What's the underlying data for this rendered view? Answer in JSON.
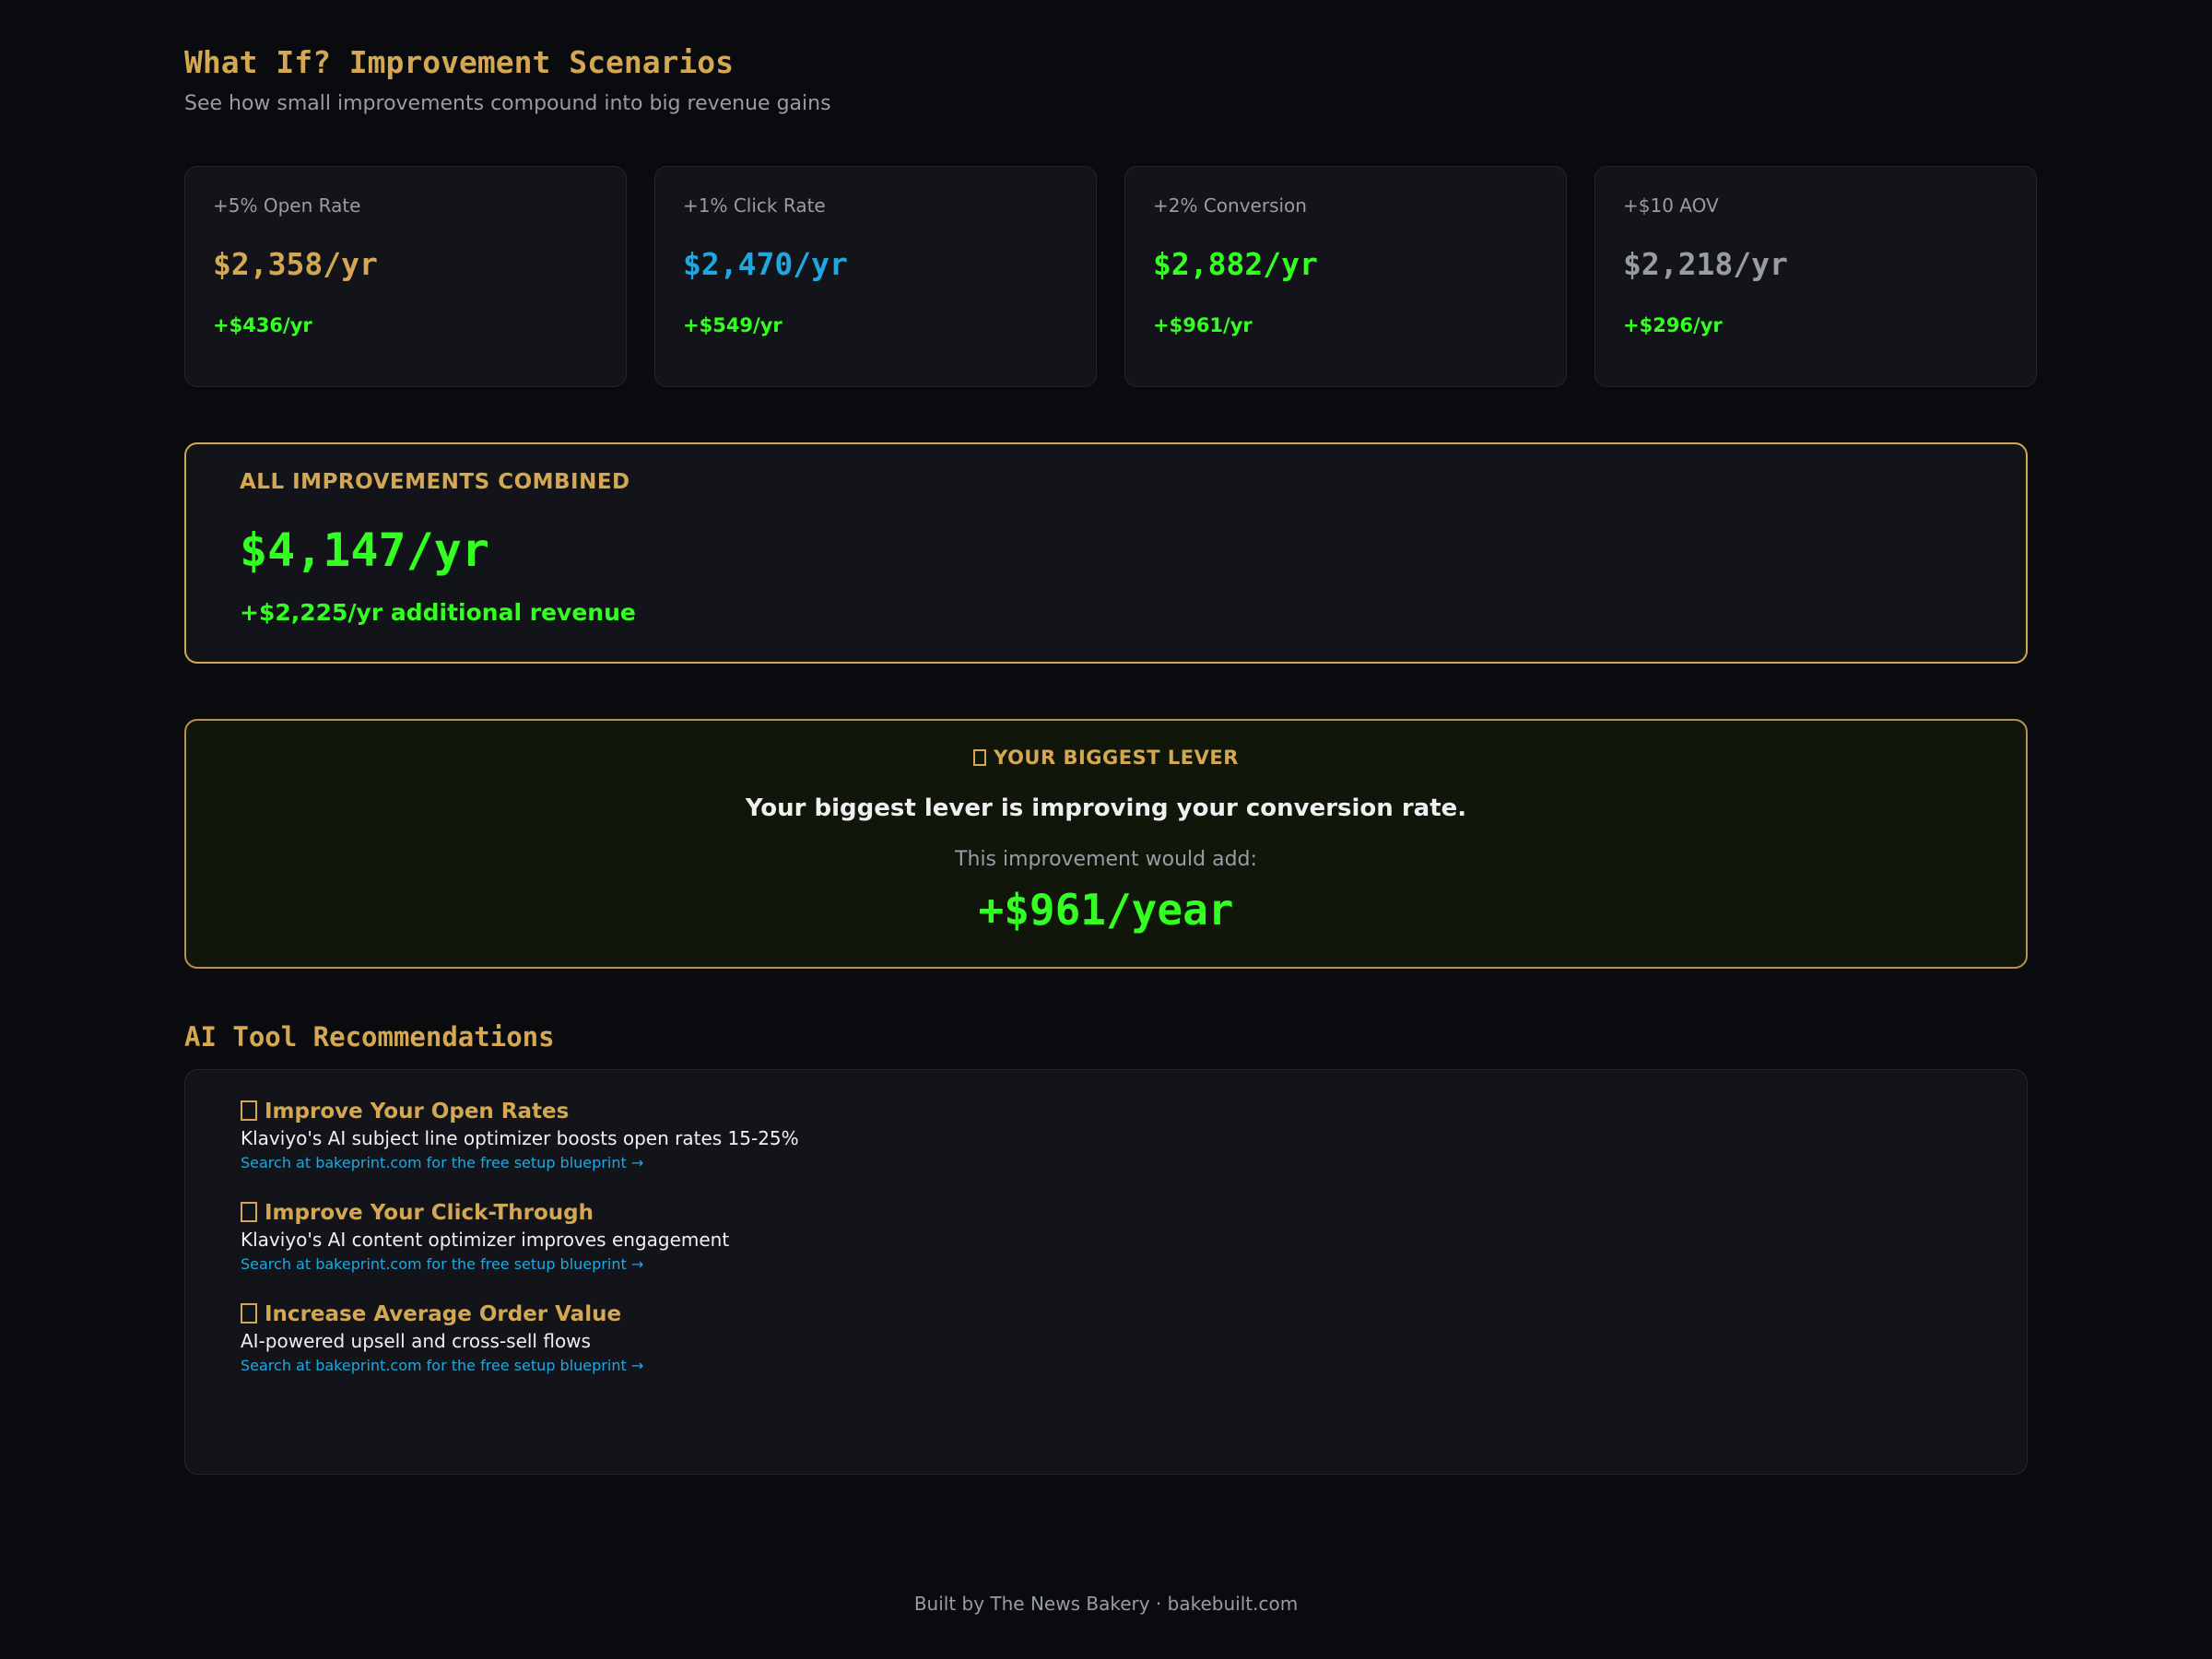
{
  "header": {
    "title": "What If? Improvement Scenarios",
    "subtitle": "See how small improvements compound into big revenue gains"
  },
  "scenarios": [
    {
      "label": "+5% Open Rate",
      "value": "$2,358/yr",
      "delta": "+$436/yr",
      "color": "#d4a853"
    },
    {
      "label": "+1% Click Rate",
      "value": "$2,470/yr",
      "delta": "+$549/yr",
      "color": "#1fa8e0"
    },
    {
      "label": "+2% Conversion",
      "value": "$2,882/yr",
      "delta": "+$961/yr",
      "color": "#33ff22"
    },
    {
      "label": "+$10 AOV",
      "value": "$2,218/yr",
      "delta": "+$296/yr",
      "color": "#9a9ca3"
    }
  ],
  "combined": {
    "heading": "ALL IMPROVEMENTS COMBINED",
    "value": "$4,147/yr",
    "additional": "+$2,225/yr additional revenue"
  },
  "lever": {
    "heading": "YOUR BIGGEST LEVER",
    "icon": "target-icon",
    "message": "Your biggest lever is improving your conversion rate.",
    "sub": "This improvement would add:",
    "amount": "+$961/year"
  },
  "recommendations": {
    "title": "AI Tool Recommendations",
    "items": [
      {
        "title": "Improve Your Open Rates",
        "icon": "mail-icon",
        "description": "Klaviyo's AI subject line optimizer boosts open rates 15-25%",
        "link": "Search at bakeprint.com for the free setup blueprint →"
      },
      {
        "title": "Improve Your Click-Through",
        "icon": "cursor-icon",
        "description": "Klaviyo's AI content optimizer improves engagement",
        "link": "Search at bakeprint.com for the free setup blueprint →"
      },
      {
        "title": "Increase Average Order Value",
        "icon": "cart-icon",
        "description": "AI-powered upsell and cross-sell flows",
        "link": "Search at bakeprint.com for the free setup blueprint →"
      }
    ]
  },
  "footer": {
    "text": "Built by The News Bakery · bakebuilt.com"
  }
}
